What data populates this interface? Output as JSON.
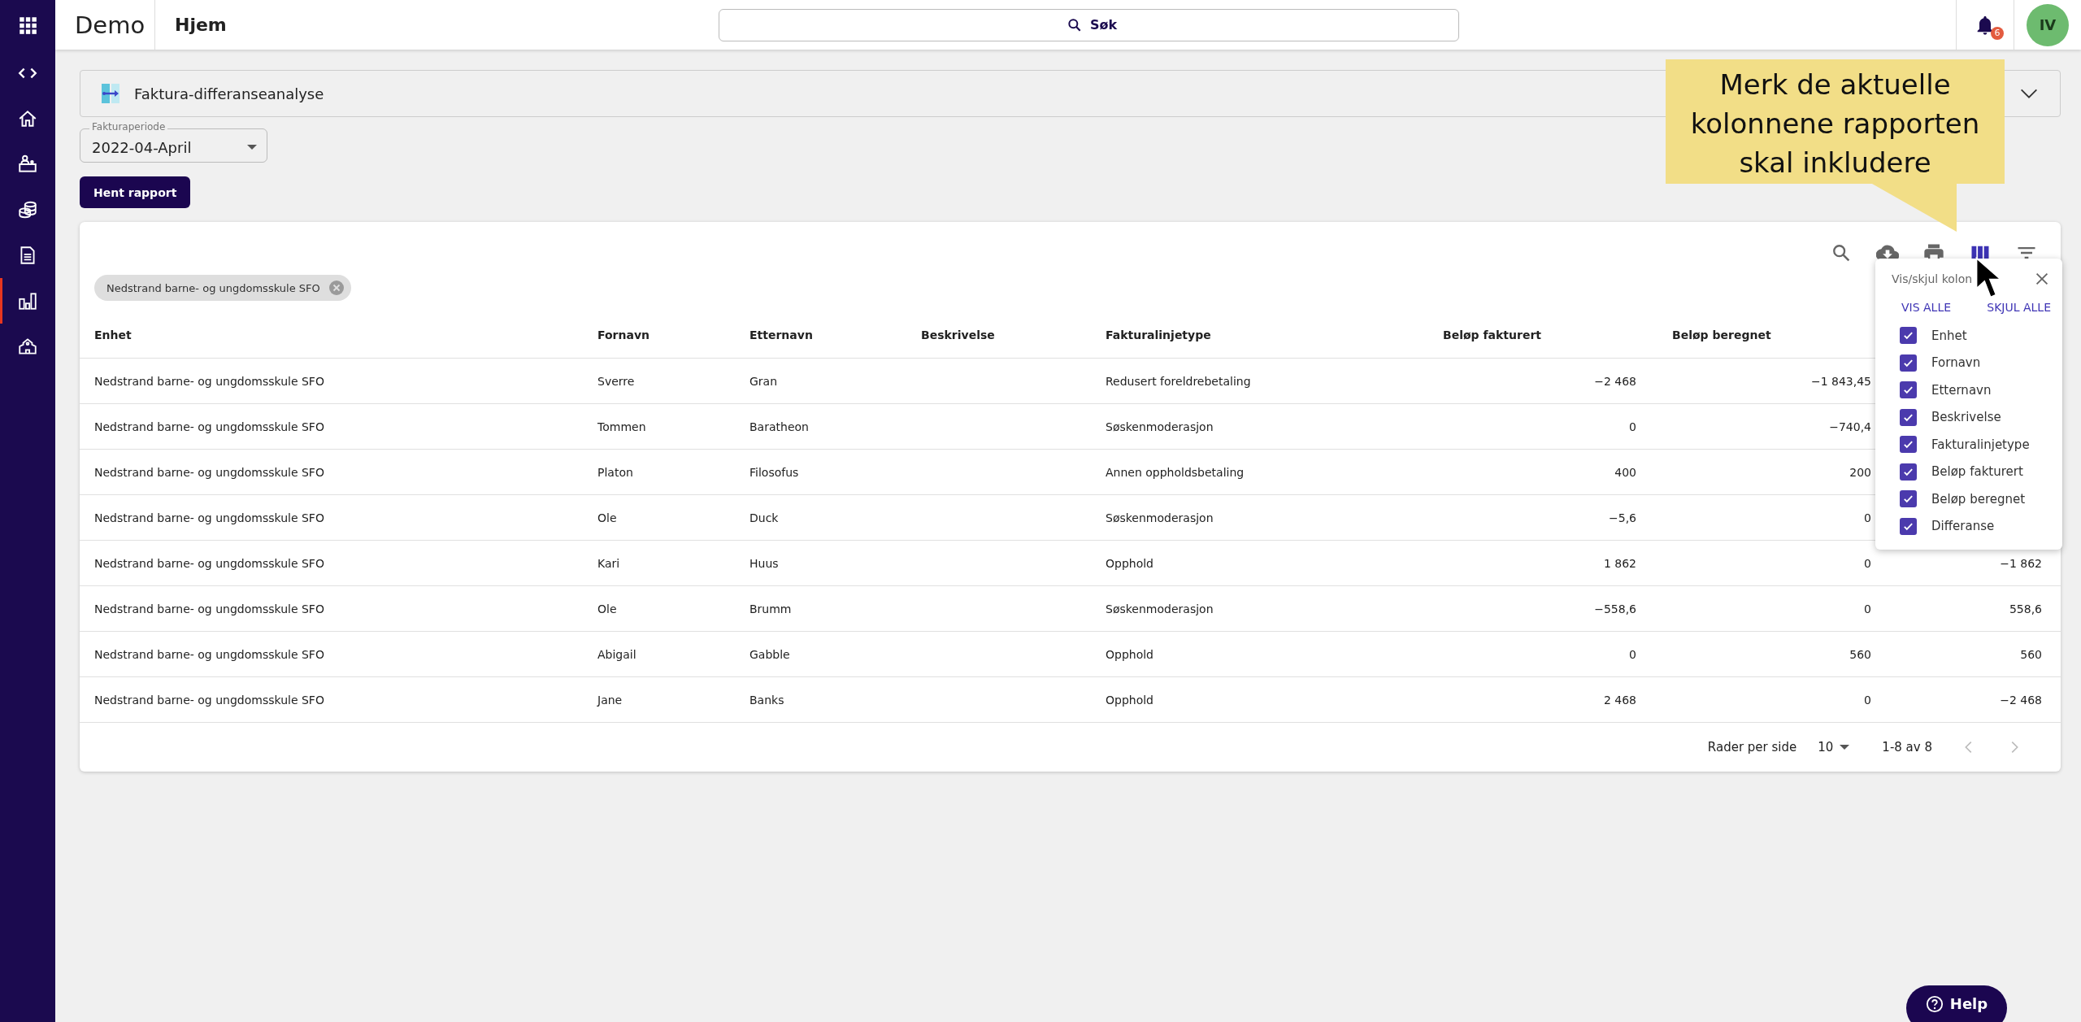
{
  "sidebar": {
    "items": [
      {
        "kind": "apps",
        "selected": false
      },
      {
        "kind": "code",
        "selected": false
      },
      {
        "kind": "home",
        "selected": false
      },
      {
        "kind": "desk",
        "selected": false
      },
      {
        "kind": "coins",
        "selected": false
      },
      {
        "kind": "document",
        "selected": false
      },
      {
        "kind": "chart",
        "selected": true
      },
      {
        "kind": "building",
        "selected": false
      }
    ]
  },
  "top_bar": {
    "app_name": "Demo",
    "page_title": "Hjem",
    "search": {
      "placeholder": "Søk"
    },
    "notifications": {
      "count": "6"
    },
    "avatar": {
      "initials": "IV"
    }
  },
  "report_panel": {
    "title": "Faktura-differanseanalyse",
    "expanded": false
  },
  "period_select": {
    "label": "Fakturaperiode",
    "value": "2022-04-April"
  },
  "fetch_button": "Hent rapport",
  "table": {
    "toolbar": [
      {
        "kind": "search",
        "selected": false
      },
      {
        "kind": "download",
        "selected": false
      },
      {
        "kind": "print",
        "selected": false
      },
      {
        "kind": "columns",
        "selected": true
      },
      {
        "kind": "filter",
        "selected": false
      }
    ],
    "filter_chips": [
      {
        "label": "Nedstrand barne- og ungdomsskule SFO"
      }
    ],
    "columns": [
      {
        "label": "Enhet"
      },
      {
        "label": "Fornavn"
      },
      {
        "label": "Etternavn"
      },
      {
        "label": "Beskrivelse"
      },
      {
        "label": "Fakturalinjetype"
      },
      {
        "label": "Beløp fakturert"
      },
      {
        "label": "Beløp beregnet"
      }
    ],
    "rows": [
      {
        "cells": [
          "Nedstrand barne- og ungdomsskule SFO",
          "Sverre",
          "Gran",
          "",
          "Redusert foreldrebetaling",
          "−2 468",
          "−1 843,45"
        ]
      },
      {
        "cells": [
          "Nedstrand barne- og ungdomsskule SFO",
          "Tommen",
          "Baratheon",
          "",
          "Søskenmoderasjon",
          "0",
          "−740,4"
        ]
      },
      {
        "cells": [
          "Nedstrand barne- og ungdomsskule SFO",
          "Platon",
          "Filosofus",
          "",
          "Annen oppholdsbetaling",
          "400",
          "200"
        ]
      },
      {
        "cells": [
          "Nedstrand barne- og ungdomsskule SFO",
          "Ole",
          "Duck",
          "",
          "Søskenmoderasjon",
          "−5,6",
          "0"
        ]
      },
      {
        "cells": [
          "Nedstrand barne- og ungdomsskule SFO",
          "Kari",
          "Huus",
          "",
          "Opphold",
          "1 862",
          "0"
        ],
        "differanse": "−1 862"
      },
      {
        "cells": [
          "Nedstrand barne- og ungdomsskule SFO",
          "Ole",
          "Brumm",
          "",
          "Søskenmoderasjon",
          "−558,6",
          "0"
        ],
        "differanse": "558,6"
      },
      {
        "cells": [
          "Nedstrand barne- og ungdomsskule SFO",
          "Abigail",
          "Gabble",
          "",
          "Opphold",
          "0",
          "560"
        ],
        "differanse": "560"
      },
      {
        "cells": [
          "Nedstrand barne- og ungdomsskule SFO",
          "Jane",
          "Banks",
          "",
          "Opphold",
          "2 468",
          "0"
        ],
        "differanse": "−2 468"
      }
    ],
    "pagination": {
      "rows_per_page_label": "Rader per side",
      "rows_per_page": "10",
      "range": "1-8 av 8",
      "prev_disabled": true,
      "next_disabled": true
    }
  },
  "column_menu": {
    "title": "Vis/skjul kolon",
    "actions": [
      "VIS ALLE",
      "SKJUL ALLE"
    ],
    "items": [
      {
        "label": "Enhet",
        "checked": true
      },
      {
        "label": "Fornavn",
        "checked": true
      },
      {
        "label": "Etternavn",
        "checked": true
      },
      {
        "label": "Beskrivelse",
        "checked": true
      },
      {
        "label": "Fakturalinjetype",
        "checked": true
      },
      {
        "label": "Beløp fakturert",
        "checked": true
      },
      {
        "label": "Beløp beregnet",
        "checked": true
      },
      {
        "label": "Differanse",
        "checked": true
      }
    ]
  },
  "callout": "Merk de aktuelle kolonnene rapporten skal inkludere",
  "help_button": "Help"
}
